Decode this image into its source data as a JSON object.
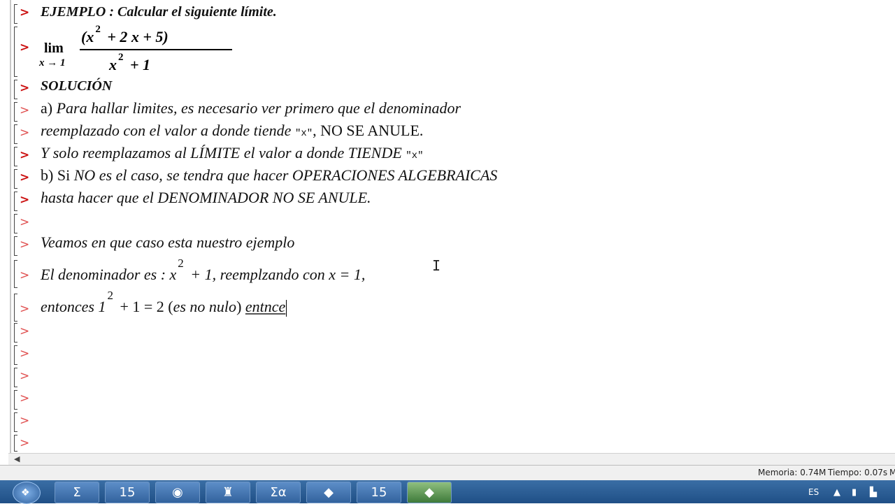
{
  "worksheet": {
    "prompt_symbol": ">",
    "header": {
      "label": "EJEMPLO :",
      "text": "Calcular el siguiente límite."
    },
    "limit": {
      "lim": "lim",
      "subscript": "x → 1",
      "numerator_open": "(x",
      "numerator_exp": "2",
      "numerator_rest": " + 2 x + 5)",
      "denominator_base": "x",
      "denominator_exp": "2",
      "denominator_rest": " + 1"
    },
    "solucion": "SOLUCIÓN",
    "line_a": {
      "prefix": "a)",
      "text": " Para  hallar limites, es necesario ver primero que el denominador"
    },
    "line_a2": {
      "text": "reemplazado con el valor a donde tiende ",
      "x": "\"x\"",
      "upright": ",  NO SE ANULE."
    },
    "line_y": {
      "text": "Y solo reemplazamos al LÍMITE el valor  a donde TIENDE  ",
      "x": "\"x\""
    },
    "line_b": {
      "prefix": "b)",
      "si": " Si ",
      "text": "NO es el caso, se tendra que hacer OPERACIONES ALGEBRAICAS"
    },
    "line_b2": {
      "text": "hasta hacer que el DENOMINADOR NO SE ANULE."
    },
    "line_veamos": {
      "text": "Veamos en que caso esta nuestro ejemplo"
    },
    "line_den": {
      "text": "El denominador es : x",
      "exp": "2",
      "rest": " + 1, reemplzando con x = 1,"
    },
    "line_ent": {
      "text": "entonces 1",
      "exp": "2",
      "rest": " + 1 = 2 (",
      "nulo": "es no nulo",
      "close": ")",
      "typed": "entnce"
    }
  },
  "status": {
    "memoria": "Memoria: 0.74M",
    "tiempo": "Tiempo: 0.07s",
    "extra": "M"
  },
  "taskbar": {
    "apps": [
      {
        "name": "maple-worksheet-icon",
        "glyph": "Σ"
      },
      {
        "name": "portal-15-icon",
        "glyph": "15"
      },
      {
        "name": "chrome-icon",
        "glyph": "◉"
      },
      {
        "name": "joystick-icon",
        "glyph": "♜"
      },
      {
        "name": "maple-math-icon",
        "glyph": "Σα"
      },
      {
        "name": "minecraft-grass-icon",
        "glyph": "◆"
      },
      {
        "name": "maple-15-icon",
        "glyph": "15"
      },
      {
        "name": "minecraft-active-icon",
        "glyph": "◆"
      }
    ],
    "lang": "ES",
    "tray_up": "▲"
  },
  "colors": {
    "prompt": "#d42020",
    "taskbar": "#2c5d99"
  }
}
